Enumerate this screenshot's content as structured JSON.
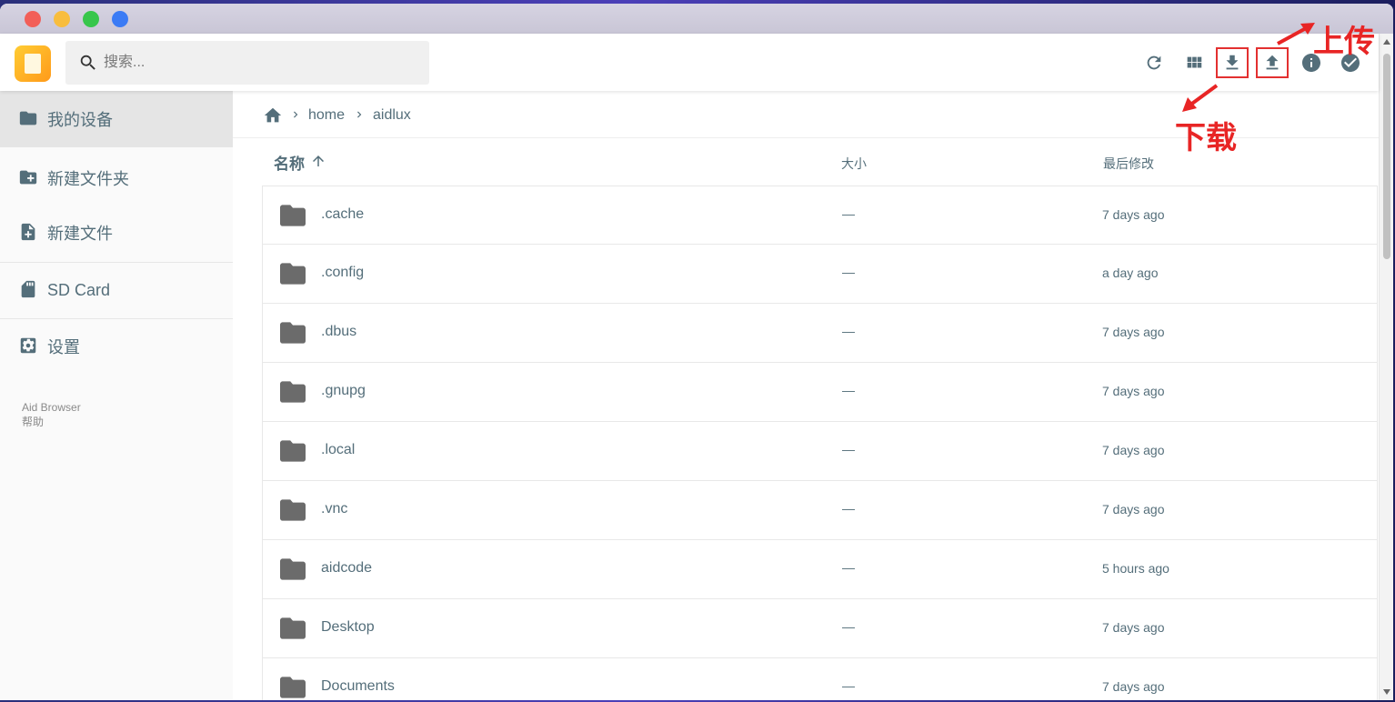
{
  "search": {
    "placeholder": "搜索..."
  },
  "toolbar": {
    "refresh_icon": "refresh-icon",
    "grid_icon": "grid-view-icon",
    "download_icon": "download-icon",
    "upload_icon": "upload-icon",
    "info_icon": "info-icon",
    "check_icon": "check-circle-icon"
  },
  "annotations": {
    "upload": "上传",
    "download": "下载",
    "color": "#e82525"
  },
  "sidebar": {
    "items": [
      {
        "label": "我的设备",
        "icon": "folder-icon"
      },
      {
        "label": "新建文件夹",
        "icon": "create-folder-icon"
      },
      {
        "label": "新建文件",
        "icon": "note-add-icon"
      },
      {
        "label": "SD Card",
        "icon": "sd-card-icon"
      },
      {
        "label": "设置",
        "icon": "settings-icon"
      }
    ],
    "footer": {
      "app": "Aid Browser",
      "help": "帮助"
    }
  },
  "breadcrumb": [
    "home",
    "aidlux"
  ],
  "table": {
    "headers": {
      "name": "名称",
      "size": "大小",
      "modified": "最后修改"
    },
    "rows": [
      {
        "name": ".cache",
        "size": "—",
        "modified": "7 days ago"
      },
      {
        "name": ".config",
        "size": "—",
        "modified": "a day ago"
      },
      {
        "name": ".dbus",
        "size": "—",
        "modified": "7 days ago"
      },
      {
        "name": ".gnupg",
        "size": "—",
        "modified": "7 days ago"
      },
      {
        "name": ".local",
        "size": "—",
        "modified": "7 days ago"
      },
      {
        "name": ".vnc",
        "size": "—",
        "modified": "7 days ago"
      },
      {
        "name": "aidcode",
        "size": "—",
        "modified": "5 hours ago"
      },
      {
        "name": "Desktop",
        "size": "—",
        "modified": "7 days ago"
      },
      {
        "name": "Documents",
        "size": "—",
        "modified": "7 days ago"
      }
    ]
  },
  "colors": {
    "text": "#546e7a",
    "icon": "#546e7a",
    "accent": "#e33030"
  }
}
